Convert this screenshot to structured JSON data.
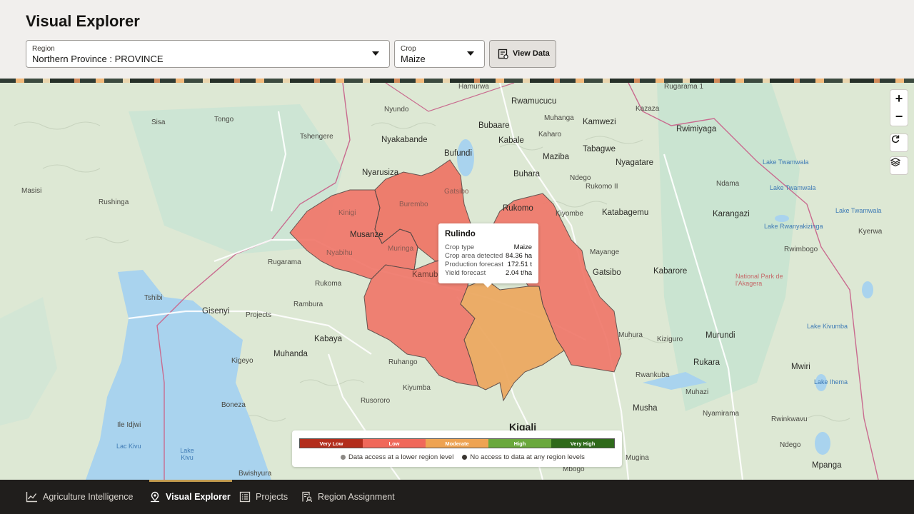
{
  "header": {
    "title": "Visual Explorer",
    "region": {
      "label": "Region",
      "value": "Northern Province : PROVINCE"
    },
    "crop": {
      "label": "Crop",
      "value": "Maize"
    },
    "view_data_label": "View Data"
  },
  "map": {
    "zoom_in": "+",
    "zoom_out": "−",
    "places": {
      "hamurwa": "Hamurwa",
      "rugarama1": "Rugarama 1",
      "kazaza": "Kazaza",
      "nyundo": "Nyundo",
      "rwamucucu": "Rwamucucu",
      "muhanga": "Muhanga",
      "kamwezi": "Kamwezi",
      "bubaare": "Bubaare",
      "kaharo": "Kaharo",
      "rwimiyaga": "Rwimiyaga",
      "tongo": "Tongo",
      "sisa": "Sisa",
      "tshengere": "Tshengere",
      "nyakabande": "Nyakabande",
      "kabale": "Kabale",
      "tabagwe": "Tabagwe",
      "bufundi": "Bufundi",
      "maziba": "Maziba",
      "nyarusiza": "Nyarusiza",
      "buhara": "Buhara",
      "ndego_n": "Ndego",
      "nyagatare": "Nyagatare",
      "lake_twamwala1": "Lake Twamwala",
      "rukomo": "Rukomo II",
      "ndama": "Ndama",
      "lake_twamwala2": "Lake Twamwala",
      "masisi": "Masisi",
      "rushinga": "Rushinga",
      "katabagemu": "Katabagemu",
      "karangazi": "Karangazi",
      "lake_twamwala3": "Lake Twamwala",
      "kiyombe": "Kiyombe",
      "lake_rwanyakizinga": "Lake Rwanyakizinga",
      "kyerwa": "Kyerwa",
      "musanze": "Musanze",
      "mayange": "Mayange",
      "rwimbogo": "Rwimbogo",
      "gatsibo": "Gatsibo",
      "kabarore": "Kabarore",
      "rugarama": "Rugarama",
      "akagera": "National Park de l'Akagera",
      "tshibi": "Tshibi",
      "rukoma": "Rukoma",
      "gisenyi": "Gisenyi",
      "rambura": "Rambura",
      "projects_map": "Projects",
      "kabaya": "Kabaya",
      "muhura": "Muhura",
      "kiziguro": "Kiziguro",
      "murundi": "Murundi",
      "lake_kivumba": "Lake Kivumba",
      "muhanda": "Muhanda",
      "kigeyo": "Kigeyo",
      "rukara": "Rukara",
      "rwankuba": "Rwankuba",
      "mwiri": "Mwiri",
      "lake_ihema": "Lake Ihema",
      "ruhango": "Ruhango",
      "kiyumba": "Kiyumba",
      "muhazi": "Muhazi",
      "boneza": "Boneza",
      "rusororo": "Rusororo",
      "musha": "Musha",
      "nyamirama": "Nyamirama",
      "rwinkwavu": "Rwinkwavu",
      "kigali": "Kigali",
      "lac_kivu": "Lac Kivu",
      "lake_kivu": "Lake Kivu",
      "ile_idjwi": "Ile Idjwi",
      "mugina": "Mugina",
      "ndego": "Ndego",
      "mbogo": "Mbogo",
      "bwishyura": "Bwishyura",
      "mpanga": "Mpanga",
      "kinigi": "Kinigi",
      "nyabihu": "Nyabihu",
      "muringa": "Muringa",
      "kamubuga": "Kamubuga",
      "burembo": "Burembo",
      "gatsibo_s": "Gatsibo",
      "rukomo_n": "Rukomo"
    }
  },
  "tooltip": {
    "title": "Rulindo",
    "rows": [
      {
        "k": "Crop type",
        "v": "Maize"
      },
      {
        "k": "Crop area detected",
        "v": "84.36 ha"
      },
      {
        "k": "Production forecast",
        "v": "172.51 t"
      },
      {
        "k": "Yield forecast",
        "v": "2.04 t/ha"
      }
    ]
  },
  "legend": {
    "levels": [
      "Very Low",
      "Low",
      "Moderate",
      "High",
      "Very High"
    ],
    "colors": [
      "#b32d1c",
      "#f0685a",
      "#eea352",
      "#6aa83c",
      "#2f6a1b"
    ],
    "note_lower": "Data access at a lower region level",
    "note_none": "No access to data at any region levels"
  },
  "nav": {
    "items": [
      "Agriculture Intelligence",
      "Visual Explorer",
      "Projects",
      "Region Assignment"
    ]
  }
}
